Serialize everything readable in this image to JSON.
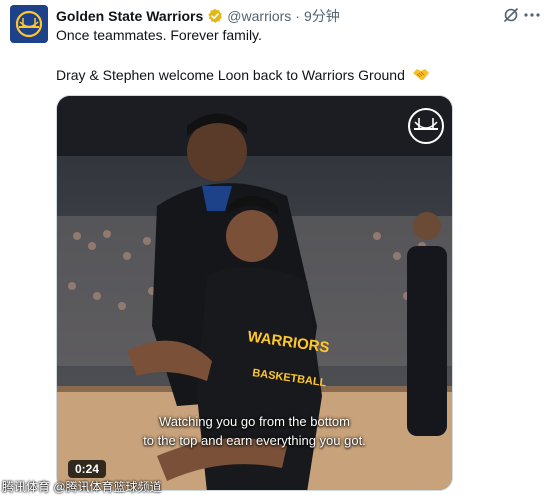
{
  "tweet": {
    "display_name": "Golden State Warriors",
    "handle": "@warriors",
    "separator": "·",
    "time": "9分钟",
    "text_line1": "Once teammates. Forever family.",
    "text_line2": "Dray & Stephen welcome Loon back to Warriors Ground",
    "emoji": "handshake-icon"
  },
  "media": {
    "duration": "0:24",
    "caption_line1": "Watching you go from the bottom",
    "caption_line2": "to the top and earn everything you got."
  },
  "watermark": "腾讯体育 @腾讯体育篮球频道",
  "colors": {
    "warriors_blue": "#1d428a",
    "warriors_gold": "#ffc72c",
    "verified_gold": "#e2b719",
    "secondary_text": "#536471"
  }
}
